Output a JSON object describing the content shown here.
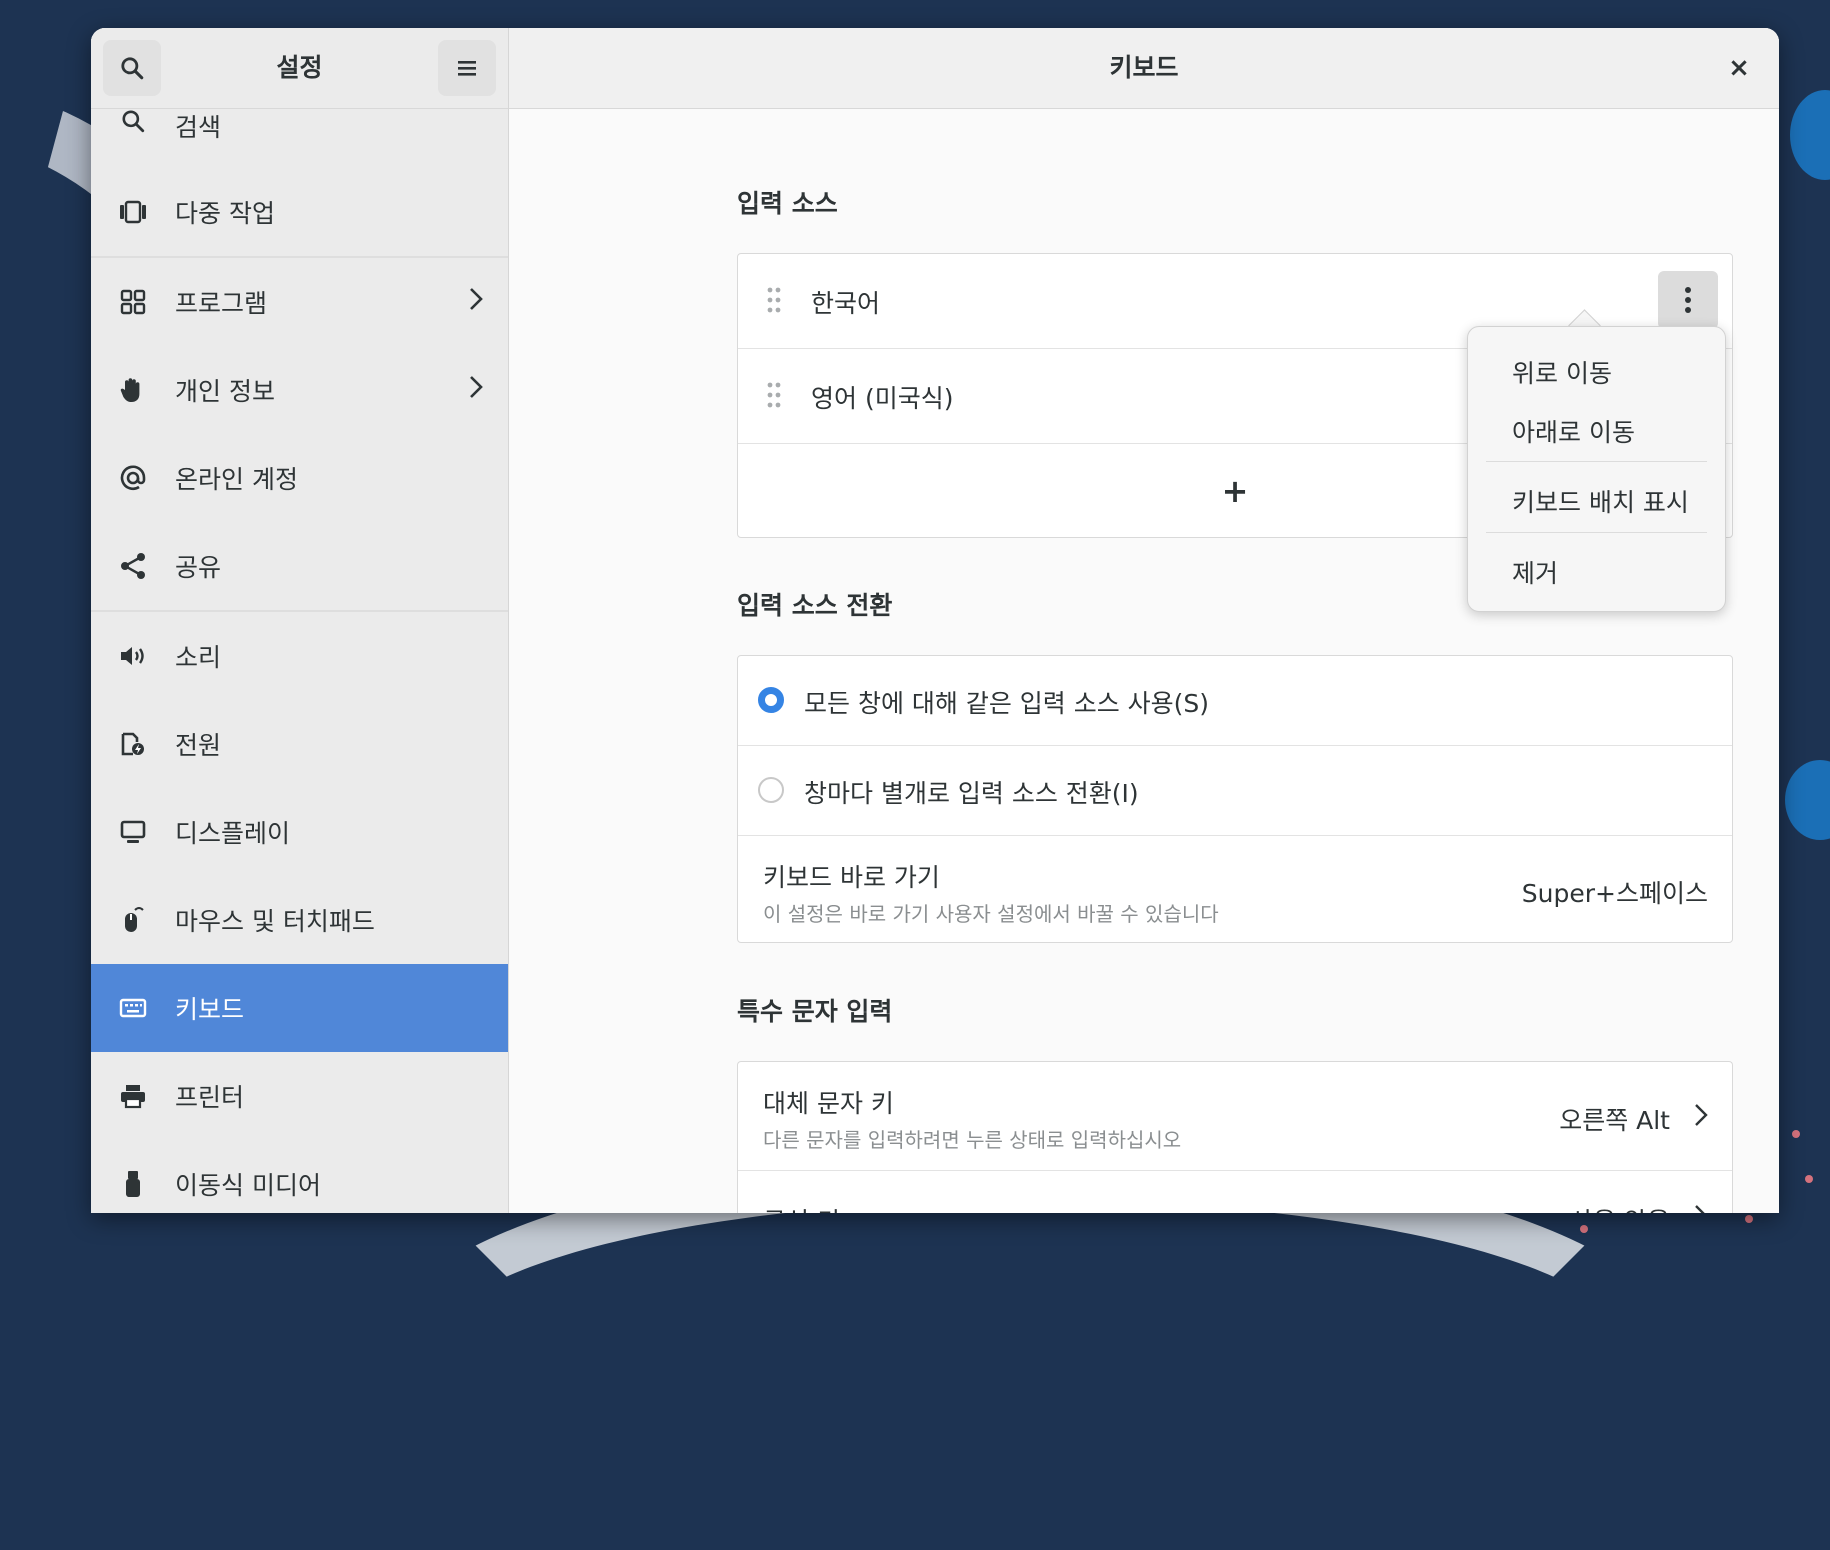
{
  "sidebar": {
    "title": "설정",
    "items": [
      {
        "label": "검색",
        "icon": "search-icon"
      },
      {
        "label": "다중 작업",
        "icon": "multitasking-icon"
      },
      {
        "label": "프로그램",
        "icon": "apps-grid-icon"
      },
      {
        "label": "개인 정보",
        "icon": "hand-icon"
      },
      {
        "label": "온라인 계정",
        "icon": "at-sign-icon"
      },
      {
        "label": "공유",
        "icon": "share-icon"
      },
      {
        "label": "소리",
        "icon": "speaker-icon"
      },
      {
        "label": "전원",
        "icon": "power-icon"
      },
      {
        "label": "디스플레이",
        "icon": "display-icon"
      },
      {
        "label": "마우스 및 터치패드",
        "icon": "mouse-icon"
      },
      {
        "label": "키보드",
        "icon": "keyboard-icon"
      },
      {
        "label": "프린터",
        "icon": "printer-icon"
      },
      {
        "label": "이동식 미디어",
        "icon": "usb-drive-icon"
      }
    ],
    "active_item": "키보드"
  },
  "header": {
    "title": "키보드",
    "close": "×"
  },
  "input_sources": {
    "title": "입력 소스",
    "items": [
      "한국어",
      "영어 (미국식)"
    ],
    "add": "+"
  },
  "popover_menu": {
    "items": [
      "위로 이동",
      "아래로 이동",
      "키보드 배치 표시",
      "제거"
    ]
  },
  "source_switching": {
    "title": "입력 소스 전환",
    "option_all": "모든 창에 대해 같은 입력 소스 사용(S)",
    "option_per_window": "창마다 별개로 입력 소스 전환(I)",
    "selected": "option_all",
    "shortcut_label": "키보드 바로 가기",
    "shortcut_sub": "이 설정은 바로 가기 사용자 설정에서 바꿀 수 있습니다",
    "shortcut_value": "Super+스페이스"
  },
  "special_chars": {
    "title": "특수 문자 입력",
    "alt_label": "대체 문자 키",
    "alt_sub": "다른 문자를 입력하려면 누른 상태로 입력하십시오",
    "alt_value": "오른쪽 Alt",
    "compose_label": "구성 키",
    "compose_value": "사용 않음"
  },
  "colors": {
    "accent": "#3584e4",
    "sidebar_active": "#5087d8"
  }
}
